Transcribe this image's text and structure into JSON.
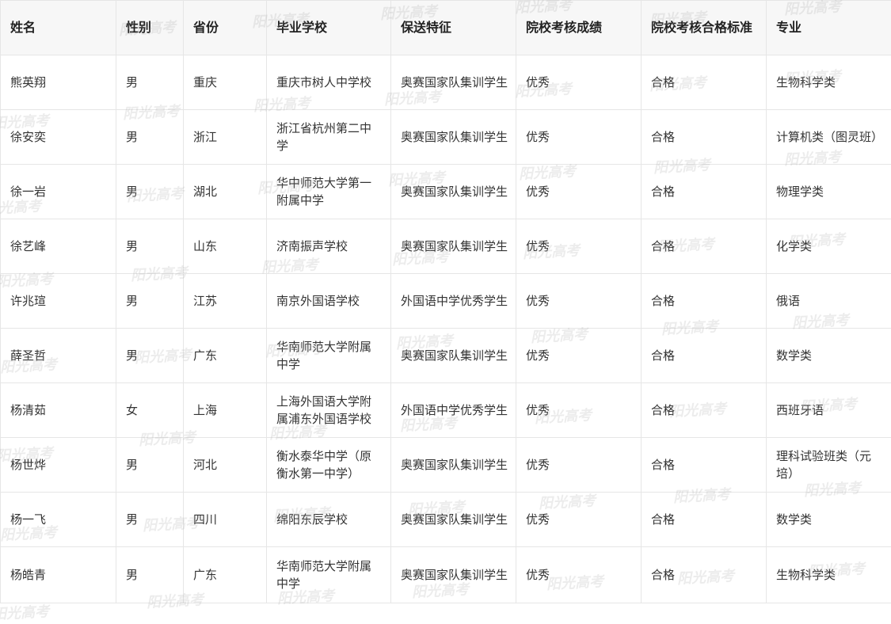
{
  "headers": [
    "姓名",
    "性别",
    "省份",
    "毕业学校",
    "保送特征",
    "院校考核成绩",
    "院校考核合格标准",
    "专业"
  ],
  "rows": [
    [
      "熊英翔",
      "男",
      "重庆",
      "重庆市树人中学校",
      "奥赛国家队集训学生",
      "优秀",
      "合格",
      "生物科学类"
    ],
    [
      "徐安奕",
      "男",
      "浙江",
      "浙江省杭州第二中学",
      "奥赛国家队集训学生",
      "优秀",
      "合格",
      "计算机类（图灵班）"
    ],
    [
      "徐一岩",
      "男",
      "湖北",
      "华中师范大学第一附属中学",
      "奥赛国家队集训学生",
      "优秀",
      "合格",
      "物理学类"
    ],
    [
      "徐艺峰",
      "男",
      "山东",
      "济南振声学校",
      "奥赛国家队集训学生",
      "优秀",
      "合格",
      "化学类"
    ],
    [
      "许兆瑄",
      "男",
      "江苏",
      "南京外国语学校",
      "外国语中学优秀学生",
      "优秀",
      "合格",
      "俄语"
    ],
    [
      "薛圣哲",
      "男",
      "广东",
      "华南师范大学附属中学",
      "奥赛国家队集训学生",
      "优秀",
      "合格",
      "数学类"
    ],
    [
      "杨清茹",
      "女",
      "上海",
      "上海外国语大学附属浦东外国语学校",
      "外国语中学优秀学生",
      "优秀",
      "合格",
      "西班牙语"
    ],
    [
      "杨世烨",
      "男",
      "河北",
      "衡水泰华中学（原衡水第一中学）",
      "奥赛国家队集训学生",
      "优秀",
      "合格",
      "理科试验班类（元培）"
    ],
    [
      "杨一飞",
      "男",
      "四川",
      "绵阳东辰学校",
      "奥赛国家队集训学生",
      "优秀",
      "合格",
      "数学类"
    ],
    [
      "杨皓青",
      "男",
      "广东",
      "华南师范大学附属中学",
      "奥赛国家队集训学生",
      "优秀",
      "合格",
      "生物科学类"
    ]
  ],
  "watermark_text": "阳光高考"
}
